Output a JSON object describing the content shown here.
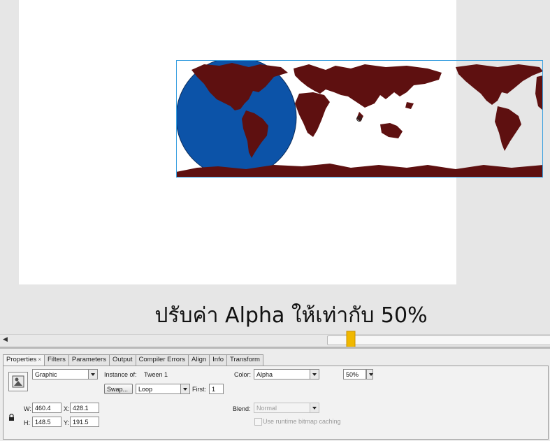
{
  "colors": {
    "stage_bg": "#ffffff",
    "globe": "#0c53a8",
    "land": "#5e1010",
    "arrow": "#f0b800",
    "selection": "#3aa0e0"
  },
  "caption": "ปรับค่า Alpha  ให้เท่ากับ 50%",
  "tabs": [
    "Properties",
    "Filters",
    "Parameters",
    "Output",
    "Compiler Errors",
    "Align",
    "Info",
    "Transform"
  ],
  "properties": {
    "symbol_type": "Graphic",
    "instance_of_label": "Instance of:",
    "instance_of_value": "Tween 1",
    "swap_label": "Swap...",
    "loop_value": "Loop",
    "first_label": "First:",
    "first_value": "1",
    "color_label": "Color:",
    "color_value": "Alpha",
    "alpha_value": "50%",
    "blend_label": "Blend:",
    "blend_value": "Normal",
    "bitmap_caching_label": "Use runtime bitmap caching",
    "w_label": "W:",
    "w_value": "460.4",
    "h_label": "H:",
    "h_value": "148.5",
    "x_label": "X:",
    "x_value": "428.1",
    "y_label": "Y:",
    "y_value": "191.5"
  },
  "icons": {
    "lock": "lock-icon",
    "tab_close": "close-icon",
    "symbol": "graphic-symbol-icon",
    "arrow": "down-arrow-icon"
  }
}
